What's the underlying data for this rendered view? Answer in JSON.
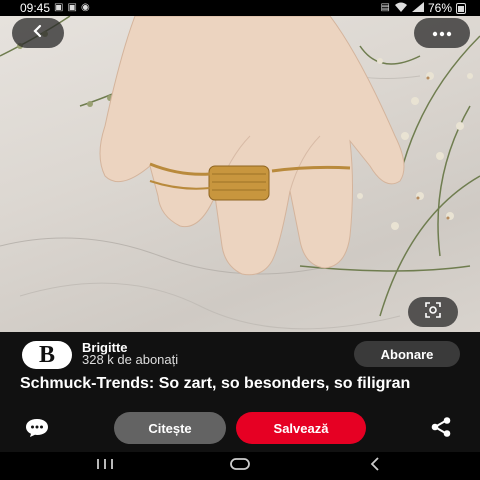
{
  "status_bar": {
    "time": "09:45",
    "battery": "76%",
    "left_icons": [
      "image-icon",
      "image-icon",
      "whatsapp-icon"
    ],
    "right_icons": [
      "alarm-icon",
      "wifi-icon",
      "signal-icon",
      "battery-icon"
    ]
  },
  "pin": {
    "image_description_icon": "hand-with-rings-photo",
    "back_icon": "chevron-left-icon",
    "more_icon": "more-horizontal-icon",
    "visual_search_icon": "lens-icon"
  },
  "publisher": {
    "logo_letter": "B",
    "name": "Brigitte",
    "followers": "328 k de abonați",
    "follow_label": "Abonare"
  },
  "title": "Schmuck-Trends: So zart, so besonders, so filigran",
  "actions": {
    "read_label": "Citește",
    "save_label": "Salvează",
    "save_color": "#e60023",
    "comment_icon": "comment-icon",
    "share_icon": "share-icon"
  },
  "nav": {
    "recents_icon": "recents-icon",
    "home_icon": "home-icon",
    "back_icon": "back-icon"
  }
}
